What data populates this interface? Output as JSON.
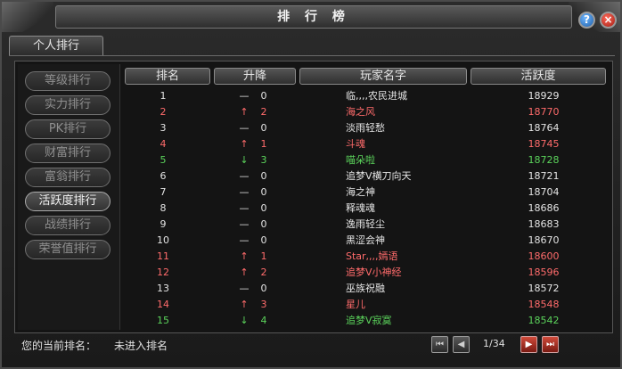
{
  "title": "排 行 榜",
  "icons": {
    "help": "?",
    "close": "×"
  },
  "tab": "个人排行",
  "sidebar": [
    {
      "label": "等级排行",
      "active": false
    },
    {
      "label": "实力排行",
      "active": false
    },
    {
      "label": "PK排行",
      "active": false
    },
    {
      "label": "财富排行",
      "active": false
    },
    {
      "label": "富翁排行",
      "active": false
    },
    {
      "label": "活跃度排行",
      "active": true
    },
    {
      "label": "战绩排行",
      "active": false
    },
    {
      "label": "荣誉值排行",
      "active": false
    }
  ],
  "columns": [
    "排名",
    "升降",
    "玩家名字",
    "活跃度"
  ],
  "rows": [
    {
      "rank": "1",
      "arrow": "—",
      "change": "0",
      "name": "临,,,,农民进城",
      "score": "18929",
      "color": "white"
    },
    {
      "rank": "2",
      "arrow": "↑",
      "change": "2",
      "name": "海之风",
      "score": "18770",
      "color": "red"
    },
    {
      "rank": "3",
      "arrow": "—",
      "change": "0",
      "name": "淡雨轻愁",
      "score": "18764",
      "color": "white"
    },
    {
      "rank": "4",
      "arrow": "↑",
      "change": "1",
      "name": "斗魂",
      "score": "18745",
      "color": "red"
    },
    {
      "rank": "5",
      "arrow": "↓",
      "change": "3",
      "name": "喵朵啦",
      "score": "18728",
      "color": "green"
    },
    {
      "rank": "6",
      "arrow": "—",
      "change": "0",
      "name": "追梦V横刀向天",
      "score": "18721",
      "color": "white"
    },
    {
      "rank": "7",
      "arrow": "—",
      "change": "0",
      "name": "海之神",
      "score": "18704",
      "color": "white"
    },
    {
      "rank": "8",
      "arrow": "—",
      "change": "0",
      "name": "释魂魂",
      "score": "18686",
      "color": "white"
    },
    {
      "rank": "9",
      "arrow": "—",
      "change": "0",
      "name": "逸雨轻尘",
      "score": "18683",
      "color": "white"
    },
    {
      "rank": "10",
      "arrow": "—",
      "change": "0",
      "name": "黑涩会神",
      "score": "18670",
      "color": "white"
    },
    {
      "rank": "11",
      "arrow": "↑",
      "change": "1",
      "name": "Star,,,,嫣语",
      "score": "18600",
      "color": "red"
    },
    {
      "rank": "12",
      "arrow": "↑",
      "change": "2",
      "name": "追梦V小神经",
      "score": "18596",
      "color": "red"
    },
    {
      "rank": "13",
      "arrow": "—",
      "change": "0",
      "name": "巫族祝融",
      "score": "18572",
      "color": "white"
    },
    {
      "rank": "14",
      "arrow": "↑",
      "change": "3",
      "name": "星儿",
      "score": "18548",
      "color": "red"
    },
    {
      "rank": "15",
      "arrow": "↓",
      "change": "4",
      "name": "追梦V寂寞",
      "score": "18542",
      "color": "green"
    }
  ],
  "footer": {
    "label": "您的当前排名：",
    "value": "未进入排名",
    "page": "1/34"
  },
  "pager": {
    "first": "⏮",
    "prev": "◀",
    "next": "▶",
    "last": "⏭"
  }
}
